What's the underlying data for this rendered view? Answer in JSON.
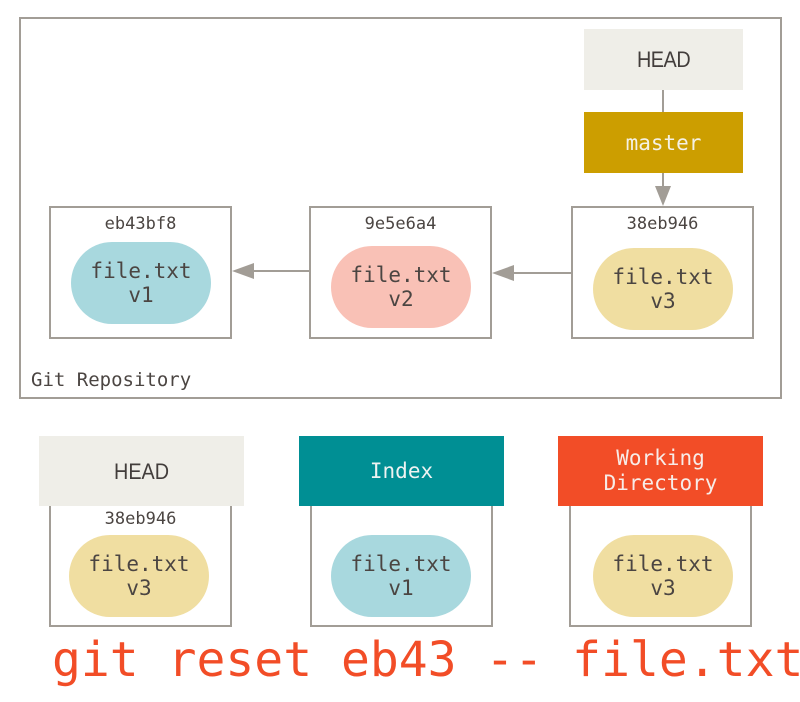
{
  "repository": {
    "label": "Git Repository",
    "refs": {
      "head": "HEAD",
      "branch": "master"
    },
    "commits": [
      {
        "hash": "eb43bf8",
        "file": "file.txt",
        "version": "v1",
        "color": "#a8d8de"
      },
      {
        "hash": "9e5e6a4",
        "file": "file.txt",
        "version": "v2",
        "color": "#f9c1b6"
      },
      {
        "hash": "38eb946",
        "file": "file.txt",
        "version": "v3",
        "color": "#f0dea1"
      }
    ]
  },
  "areas": [
    {
      "title": "HEAD",
      "hash": "38eb946",
      "file": "file.txt",
      "version": "v3",
      "header_color": "#efeee8",
      "blob_color": "#f0dea1"
    },
    {
      "title": "Index",
      "file": "file.txt",
      "version": "v1",
      "header_color": "#008f94",
      "blob_color": "#a8d8de"
    },
    {
      "title_line1": "Working",
      "title_line2": "Directory",
      "file": "file.txt",
      "version": "v3",
      "header_color": "#f24d27",
      "blob_color": "#f0dea1"
    }
  ],
  "command": "git reset eb43 -- file.txt",
  "colors": {
    "border": "#a29d96",
    "branch": "#cc9e00",
    "head": "#efeee8",
    "index": "#008f94",
    "working_directory": "#f24d27",
    "command": "#f24d27"
  }
}
